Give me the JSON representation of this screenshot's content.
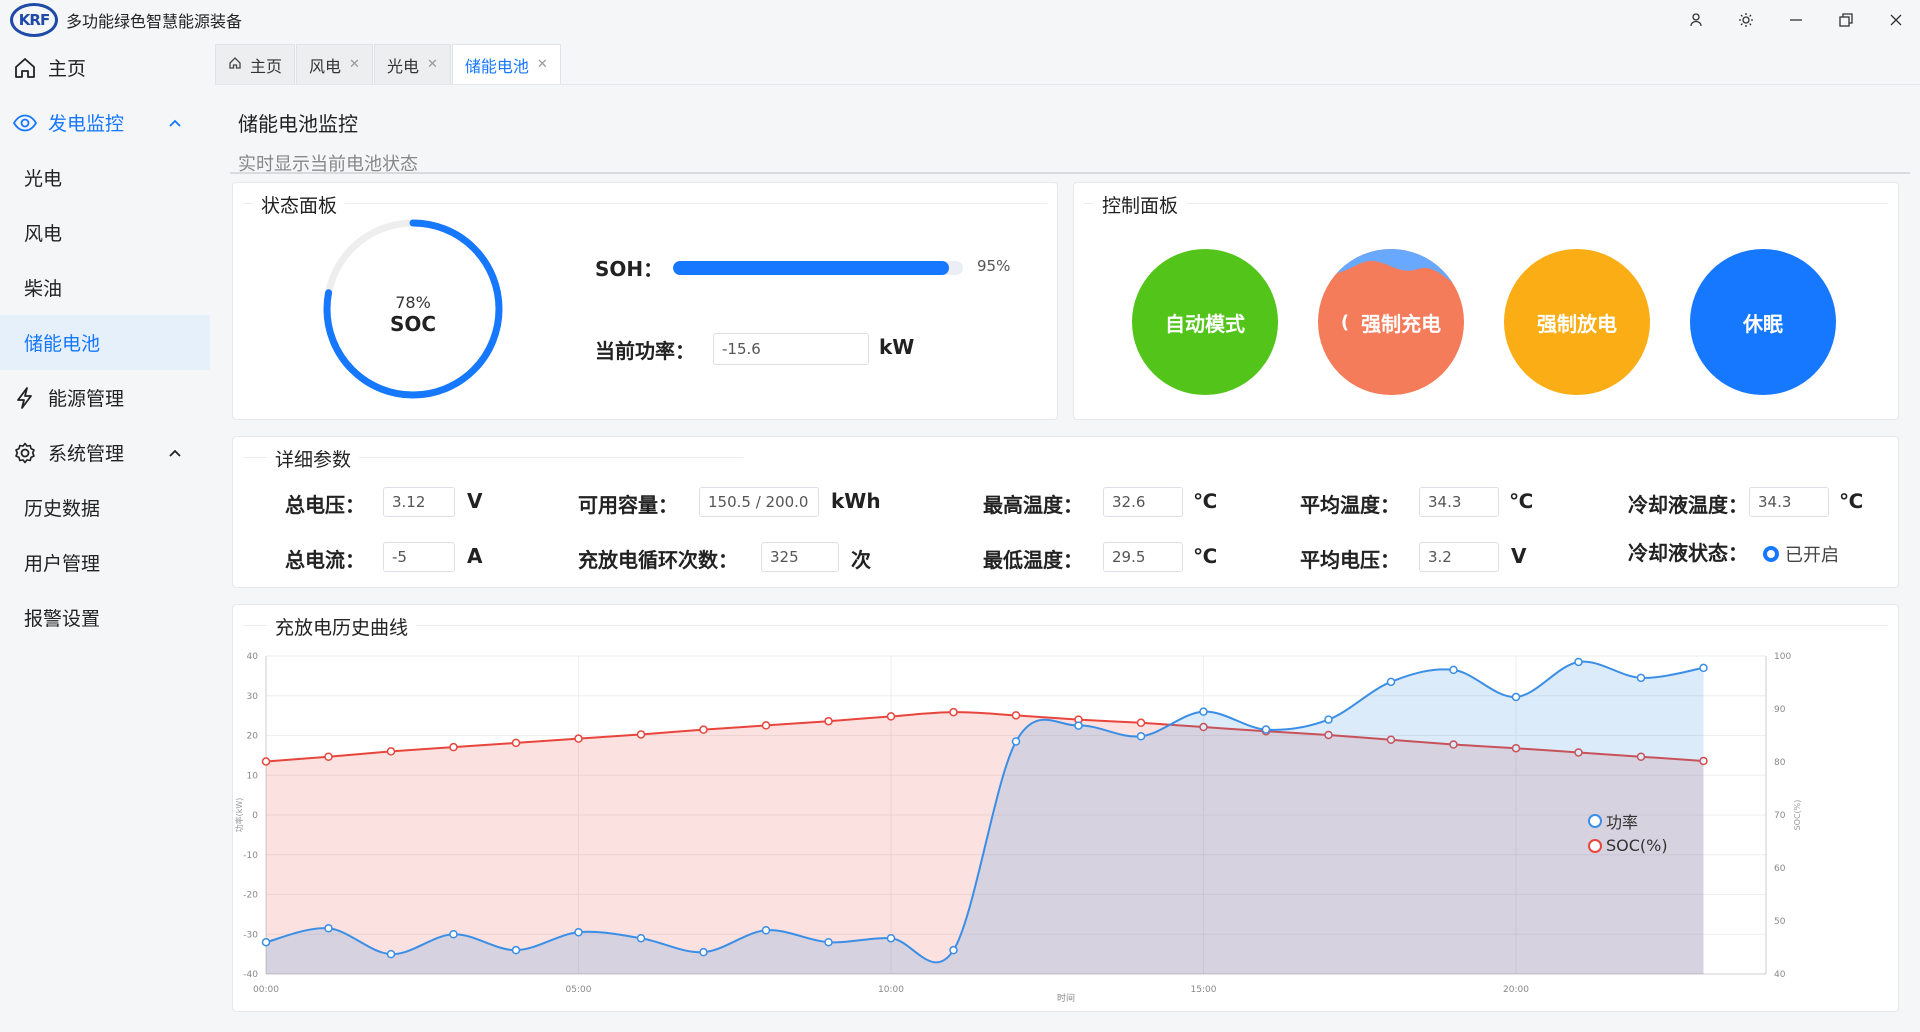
{
  "app": {
    "title": "多功能绿色智慧能源装备",
    "logo_text": "KRF"
  },
  "window_controls": [
    "user-icon",
    "settings-icon",
    "minimize-icon",
    "restore-icon",
    "close-icon"
  ],
  "sidebar": {
    "home": "主页",
    "monitor_group": "发电监控",
    "monitor_items": [
      "光电",
      "风电",
      "柴油",
      "储能电池"
    ],
    "energy": "能源管理",
    "system_group": "系统管理",
    "system_items": [
      "历史数据",
      "用户管理",
      "报警设置"
    ]
  },
  "tabs": [
    {
      "label": "主页"
    },
    {
      "label": "风电"
    },
    {
      "label": "光电"
    },
    {
      "label": "储能电池"
    }
  ],
  "page": {
    "title": "储能电池监控",
    "subtitle": "实时显示当前电池状态"
  },
  "status_panel": {
    "title": "状态面板",
    "soc_percent_text": "78%",
    "soc_fraction": 0.78,
    "soc_label": "SOC",
    "soh_label": "SOH：",
    "soh_value_text": "95%",
    "soh_fraction": 0.95,
    "power_label": "当前功率：",
    "power_value": "-15.6",
    "power_unit": "kW"
  },
  "control_panel": {
    "title": "控制面板",
    "buttons": [
      "自动模式",
      "强制充电",
      "强制放电",
      "休眠"
    ],
    "colors": [
      "#52c41a",
      "#f47c5a",
      "#faad14",
      "#1677ff"
    ],
    "charging_wave_color": "#69a8ff"
  },
  "details": {
    "title": "详细参数",
    "total_voltage_label": "总电压：",
    "total_voltage": "3.12",
    "total_voltage_unit": "V",
    "total_current_label": "总电流：",
    "total_current": "-5",
    "total_current_unit": "A",
    "capacity_label": "可用容量：",
    "capacity": "150.5 / 200.0",
    "capacity_unit": "kWh",
    "cycles_label": "充放电循环次数：",
    "cycles": "325",
    "cycles_unit": "次",
    "max_temp_label": "最高温度：",
    "max_temp": "32.6",
    "min_temp_label": "最低温度：",
    "min_temp": "29.5",
    "temp_unit": "℃",
    "avg_temp_label": "平均温度：",
    "avg_temp": "34.3",
    "avg_voltage_label": "平均电压：",
    "avg_voltage": "3.2",
    "avg_voltage_unit": "V",
    "coolant_temp_label": "冷却液温度：",
    "coolant_temp": "34.3",
    "coolant_state_label": "冷却液状态：",
    "coolant_state": "已开启"
  },
  "chart_card": {
    "title": "充放电历史曲线"
  },
  "chart_data": {
    "type": "line",
    "x": [
      "00:00",
      "01:00",
      "02:00",
      "03:00",
      "04:00",
      "05:00",
      "06:00",
      "07:00",
      "08:00",
      "09:00",
      "10:00",
      "11:00",
      "12:00",
      "13:00",
      "14:00",
      "15:00",
      "16:00",
      "17:00",
      "18:00",
      "19:00",
      "20:00",
      "21:00",
      "22:00",
      "23:00"
    ],
    "x_ticks": [
      "00:00",
      "05:00",
      "10:00",
      "15:00",
      "20:00"
    ],
    "xlabel": "时间",
    "ylabel_left": "功率(kW)",
    "ylabel_right": "SOC(%)",
    "ylim_left": [
      -40,
      40
    ],
    "ylim_right": [
      40,
      100
    ],
    "y_ticks_left": [
      40,
      30,
      20,
      10,
      0,
      -10,
      -20,
      -30,
      -40
    ],
    "y_ticks_right": [
      100,
      90,
      80,
      70,
      60,
      50,
      40
    ],
    "series": [
      {
        "name": "功率",
        "axis": "left",
        "color": "#3a8ee6",
        "values": [
          -32,
          -28.5,
          -35,
          -30,
          -34,
          -29.5,
          -31,
          -34.5,
          -29,
          -32,
          -31,
          -34,
          18.5,
          22.5,
          19.8,
          26,
          21.5,
          24,
          33.5,
          36.5,
          29.7,
          38.5,
          34.5,
          37
        ]
      },
      {
        "name": "SOC(%)",
        "axis": "right",
        "color": "#e8453c",
        "values": [
          80.1,
          81.0,
          82.0,
          82.8,
          83.6,
          84.4,
          85.2,
          86.1,
          86.9,
          87.7,
          88.6,
          89.4,
          88.8,
          88.0,
          87.4,
          86.6,
          85.8,
          85.1,
          84.2,
          83.3,
          82.6,
          81.8,
          81.0,
          80.2
        ]
      }
    ],
    "legend_position": "right"
  }
}
